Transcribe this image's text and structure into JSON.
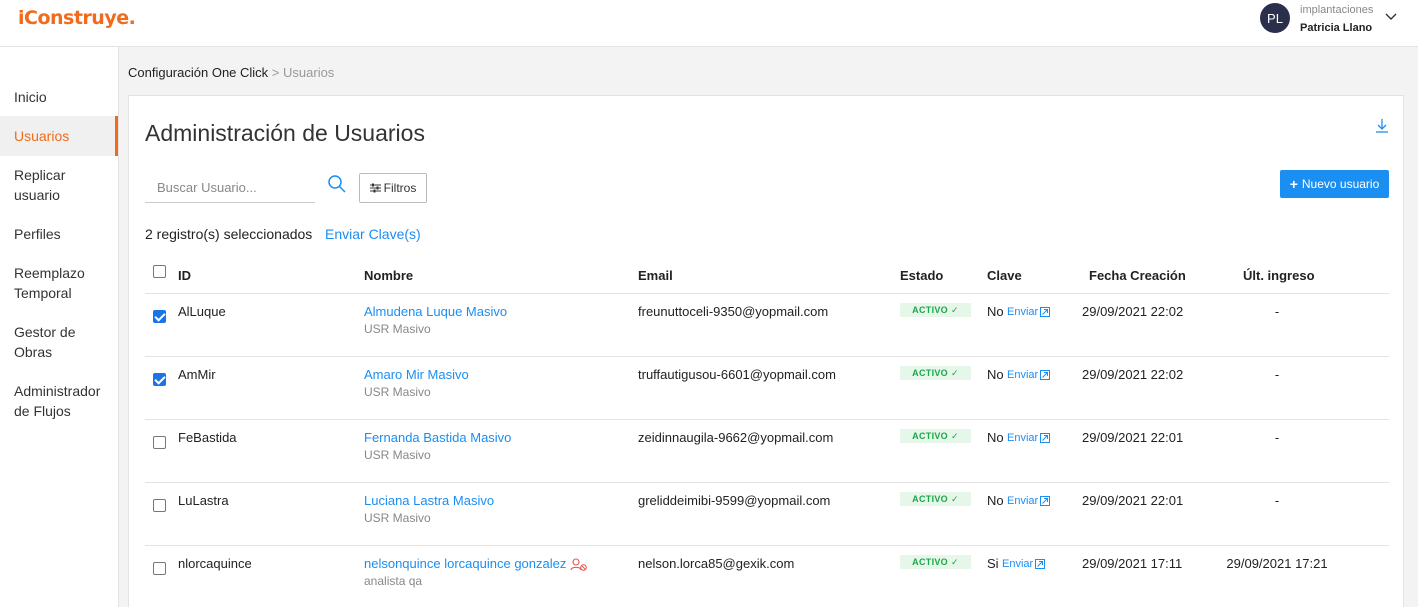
{
  "header": {
    "logo": "iConstruye.",
    "avatar_initials": "PL",
    "company": "implantaciones",
    "user_name": "Patricia Llano"
  },
  "sidebar": {
    "items": [
      {
        "label": "Inicio"
      },
      {
        "label": "Usuarios",
        "active": true
      },
      {
        "label": "Replicar usuario"
      },
      {
        "label": "Perfiles"
      },
      {
        "label": "Reemplazo Temporal"
      },
      {
        "label": "Gestor de Obras"
      },
      {
        "label": "Administrador de Flujos"
      }
    ]
  },
  "breadcrumb": {
    "parent": "Configuración One Click",
    "separator": " > ",
    "current": "Usuarios"
  },
  "main": {
    "title": "Administración de Usuarios",
    "search_placeholder": "Buscar Usuario...",
    "filters_label": "Filtros",
    "new_user_label": "Nuevo usuario",
    "selected_count": "2",
    "selected_text": " registro(s) seleccionados",
    "send_keys_label": "Enviar Clave(s)"
  },
  "table": {
    "columns": {
      "id": "ID",
      "name": "Nombre",
      "email": "Email",
      "status": "Estado",
      "key": "Clave",
      "created": "Fecha Creación",
      "last_login": "Últ. ingreso"
    },
    "send_label": "Enviar",
    "rows": [
      {
        "checked": true,
        "id": "AlLuque",
        "name": "Almudena Luque Masivo",
        "profile": "USR Masivo",
        "email": "freunuttoceli-9350@yopmail.com",
        "status": "ACTIVO",
        "key": "No",
        "created": "29/09/2021 22:02",
        "last_login": "-"
      },
      {
        "checked": true,
        "id": "AmMir",
        "name": "Amaro Mir Masivo",
        "profile": "USR Masivo",
        "email": "truffautigusou-6601@yopmail.com",
        "status": "ACTIVO",
        "key": "No",
        "created": "29/09/2021 22:02",
        "last_login": "-"
      },
      {
        "checked": false,
        "id": "FeBastida",
        "name": "Fernanda Bastida Masivo",
        "profile": "USR Masivo",
        "email": "zeidinnaugila-9662@yopmail.com",
        "status": "ACTIVO",
        "key": "No",
        "created": "29/09/2021 22:01",
        "last_login": "-"
      },
      {
        "checked": false,
        "id": "LuLastra",
        "name": "Luciana Lastra Masivo",
        "profile": "USR Masivo",
        "email": "greliddeimibi-9599@yopmail.com",
        "status": "ACTIVO",
        "key": "No",
        "created": "29/09/2021 22:01",
        "last_login": "-"
      },
      {
        "checked": false,
        "id": "nlorcaquince",
        "name": "nelsonquince lorcaquince gonzalez",
        "profile": "analista qa",
        "email": "nelson.lorca85@gexik.com",
        "status": "ACTIVO",
        "key": "Si",
        "created": "29/09/2021 17:11",
        "last_login": "29/09/2021 17:21",
        "flag_icon": "user-x-icon"
      }
    ]
  },
  "colors": {
    "brand": "#f26a1b",
    "link": "#1b8ef2",
    "status_green": "#1aa64a"
  }
}
